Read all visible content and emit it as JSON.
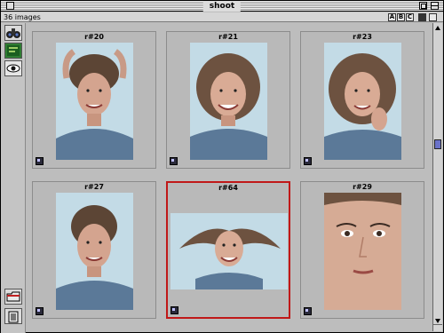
{
  "window": {
    "title": "shoot"
  },
  "status": {
    "count": "36 images",
    "buttons": [
      "A",
      "B",
      "C"
    ]
  },
  "toolbar": {
    "tools": [
      "binoculars-icon",
      "edit-icon",
      "eye-icon"
    ],
    "bottom": [
      "folder-icon",
      "trash-icon"
    ]
  },
  "images": [
    {
      "label": "r#20",
      "selected": false,
      "pose": "hands-up"
    },
    {
      "label": "r#21",
      "selected": false,
      "pose": "smile-tilt"
    },
    {
      "label": "r#23",
      "selected": false,
      "pose": "hand-cheek"
    },
    {
      "label": "r#27",
      "selected": false,
      "pose": "portrait"
    },
    {
      "label": "r#64",
      "selected": true,
      "pose": "hair-flying"
    },
    {
      "label": "r#29",
      "selected": false,
      "pose": "closeup"
    }
  ]
}
